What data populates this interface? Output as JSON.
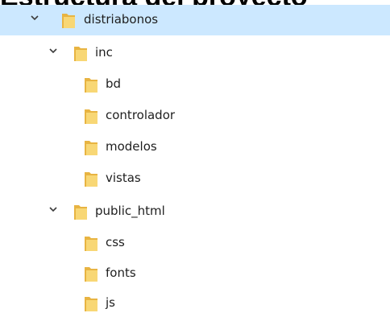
{
  "heading": "Estructura del proyecto",
  "tree": {
    "items": [
      {
        "label": "distriabonos",
        "level": 0,
        "expanded": true,
        "selected": true
      },
      {
        "label": "inc",
        "level": 1,
        "expanded": true,
        "selected": false
      },
      {
        "label": "bd",
        "level": 2,
        "selected": false
      },
      {
        "label": "controlador",
        "level": 2,
        "selected": false
      },
      {
        "label": "modelos",
        "level": 2,
        "selected": false
      },
      {
        "label": "vistas",
        "level": 2,
        "selected": false
      },
      {
        "label": "public_html",
        "level": 1,
        "expanded": true,
        "selected": false
      },
      {
        "label": "css",
        "level": 2,
        "selected": false
      },
      {
        "label": "fonts",
        "level": 2,
        "selected": false
      },
      {
        "label": "js",
        "level": 2,
        "selected": false
      }
    ]
  },
  "colors": {
    "selection": "#cce8ff",
    "folder_front": "#f8d775",
    "folder_back": "#e8b442",
    "chevron": "#3c3c3c"
  },
  "icons": {
    "folder": "folder-icon",
    "expanded": "chevron-down-icon"
  }
}
